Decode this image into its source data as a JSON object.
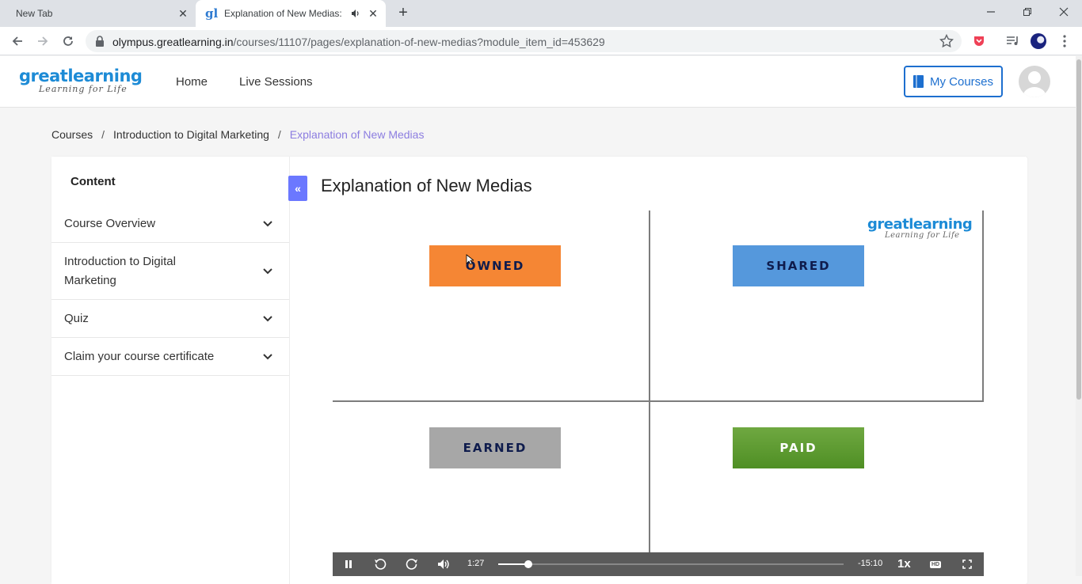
{
  "browser": {
    "tabs": [
      {
        "title": "New Tab"
      },
      {
        "title": "Explanation of New Medias: Learning"
      }
    ],
    "url_host": "olympus.greatlearning.in",
    "url_path": "/courses/11107/pages/explanation-of-new-medias?module_item_id=453629"
  },
  "site": {
    "logo_word": "greatlearning",
    "logo_tag": "Learning for Life",
    "nav": [
      "Home",
      "Live Sessions"
    ],
    "my_courses": "My Courses",
    "brand_color": "#1d6fcf"
  },
  "breadcrumb": [
    "Courses",
    "Introduction to Digital Marketing",
    "Explanation of New Medias"
  ],
  "sidebar": {
    "heading": "Content",
    "items": [
      {
        "label": "Course Overview"
      },
      {
        "label": "Introduction to Digital Marketing"
      },
      {
        "label": "Quiz"
      },
      {
        "label": "Claim your course certificate"
      }
    ]
  },
  "page_title": "Explanation of New Medias",
  "video": {
    "logo_word": "greatlearning",
    "logo_tag": "Learning for Life",
    "quadrants": {
      "owned": "OWNED",
      "shared": "SHARED",
      "earned": "EARNED",
      "paid": "PAID"
    },
    "colors": {
      "owned": "#f58634",
      "shared": "#5598dc",
      "earned": "#a7a7a7",
      "paid": "#5f9c33"
    },
    "current_time": "1:27",
    "remaining_time": "-15:10",
    "speed": "1x",
    "hd_label": "HD",
    "progress": 0.087
  }
}
